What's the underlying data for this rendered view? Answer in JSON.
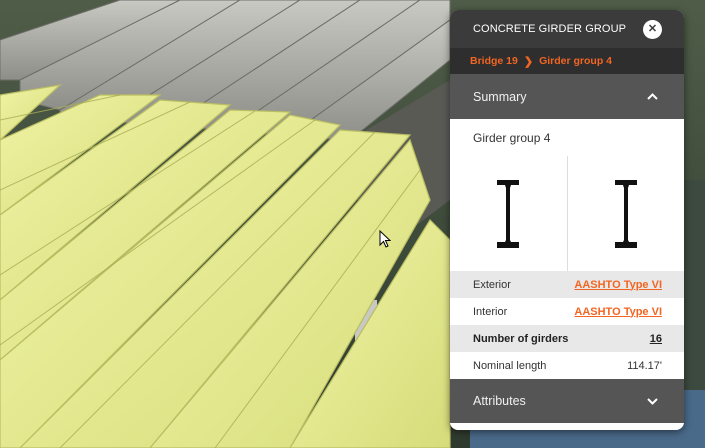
{
  "panel": {
    "title": "CONCRETE GIRDER GROUP",
    "close_symbol": "✕",
    "breadcrumb": {
      "parent": "Bridge 19",
      "separator": "❯",
      "current": "Girder group 4"
    },
    "summary": {
      "heading": "Summary",
      "expanded": true,
      "group_name": "Girder group 4",
      "profiles": [
        {
          "role": "exterior",
          "icon": "i-beam-icon"
        },
        {
          "role": "interior",
          "icon": "i-beam-icon"
        }
      ],
      "properties": [
        {
          "label": "Exterior",
          "value": "AASHTO Type VI"
        },
        {
          "label": "Interior",
          "value": "AASHTO Type VI"
        },
        {
          "label": "Number of girders",
          "value": "16"
        },
        {
          "label": "Nominal length",
          "value": "114.17'"
        }
      ]
    },
    "attributes": {
      "heading": "Attributes",
      "expanded": false
    }
  },
  "colors": {
    "accent": "#f26522",
    "header_bg": "#3b3b3b",
    "section_bg": "#555555",
    "girder_yellow": "#e6ec8e"
  }
}
